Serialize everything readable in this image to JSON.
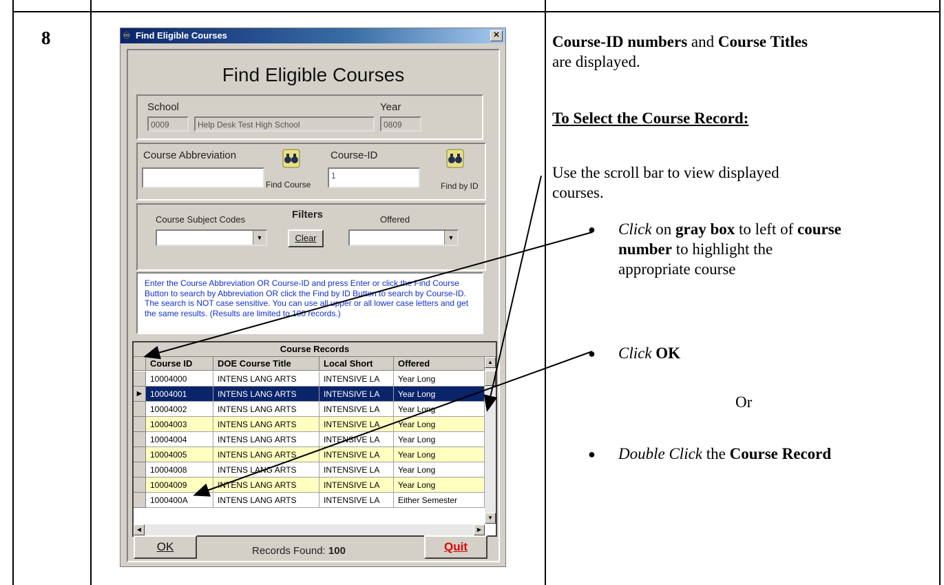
{
  "step_number": "8",
  "window": {
    "title": "Find Eligible Courses",
    "heading": "Find Eligible Courses",
    "close_glyph": "✕"
  },
  "school": {
    "label": "School",
    "code": "0009",
    "name": "Help Desk Test High School",
    "year_label": "Year",
    "year": "0809"
  },
  "search": {
    "abbrev_label": "Course Abbreviation",
    "abbrev_value": "",
    "find_course_label": "Find Course",
    "courseid_label": "Course-ID",
    "courseid_value": "1",
    "find_by_id_label": "Find by ID"
  },
  "filters": {
    "title": "Filters",
    "subject_label": "Course Subject Codes",
    "offered_label": "Offered",
    "clear_label": "Clear",
    "subject_value": "",
    "offered_value": ""
  },
  "info_text": "Enter the Course Abbreviation OR Course-ID and press Enter or click the Find Course Button to search by Abbreviation OR click the Find by ID Button to search by Course-ID.  The search is NOT case sensitive. You can use all upper or all lower case letters and get the same results. (Results are limited to 100 records.)",
  "grid": {
    "caption": "Course Records",
    "columns": [
      "Course ID",
      "DOE Course Title",
      "Local Short",
      "Offered"
    ],
    "rows": [
      {
        "id": "10004000",
        "title": "INTENS LANG ARTS",
        "short": "INTENSIVE LA",
        "offered": "Year Long",
        "style": "white"
      },
      {
        "id": "10004001",
        "title": "INTENS LANG ARTS",
        "short": "INTENSIVE LA",
        "offered": "Year Long",
        "style": "selected"
      },
      {
        "id": "10004002",
        "title": "INTENS LANG ARTS",
        "short": "INTENSIVE LA",
        "offered": "Year Long",
        "style": "white"
      },
      {
        "id": "10004003",
        "title": "INTENS LANG ARTS",
        "short": "INTENSIVE LA",
        "offered": "Year Long",
        "style": "yellow"
      },
      {
        "id": "10004004",
        "title": "INTENS LANG ARTS",
        "short": "INTENSIVE LA",
        "offered": "Year Long",
        "style": "white"
      },
      {
        "id": "10004005",
        "title": "INTENS LANG ARTS",
        "short": "INTENSIVE LA",
        "offered": "Year Long",
        "style": "yellow"
      },
      {
        "id": "10004008",
        "title": "INTENS LANG ARTS",
        "short": "INTENSIVE LA",
        "offered": "Year Long",
        "style": "white"
      },
      {
        "id": "10004009",
        "title": "INTENS LANG ARTS",
        "short": "INTENSIVE LA",
        "offered": "Year Long",
        "style": "yellow"
      },
      {
        "id": "1000400A",
        "title": "INTENS LANG ARTS",
        "short": "INTENSIVE LA",
        "offered": "Either Semester",
        "style": "white"
      }
    ]
  },
  "footer": {
    "ok_label": "OK",
    "records_label": "Records Found:",
    "records_count": "100",
    "quit_label": "Quit"
  },
  "instructions": {
    "intro_bold1": "Course-ID numbers",
    "intro_and": " and ",
    "intro_bold2": "Course Titles",
    "intro_rest": "are displayed.",
    "heading": "To Select the Course Record:",
    "scroll_line1": "Use the scroll bar to view displayed",
    "scroll_line2": "courses.",
    "b1_italic": "Click",
    "b1_on": " on ",
    "b1_bold1": "gray box",
    "b1_mid": " to left of ",
    "b1_bold2": "course",
    "b1_bold3": "number",
    "b1_rest": " to highlight the",
    "b1_line3": "appropriate course",
    "b2_italic": "Click",
    "b2_bold": "OK",
    "or": "Or",
    "b3_italic": "Double Click",
    "b3_the": " the ",
    "b3_bold": "Course Record"
  },
  "colors": {
    "selected_bg": "#0a246a",
    "yellow_row": "#ffffc0",
    "quit_red": "#e00000",
    "info_blue": "#1030d0"
  }
}
